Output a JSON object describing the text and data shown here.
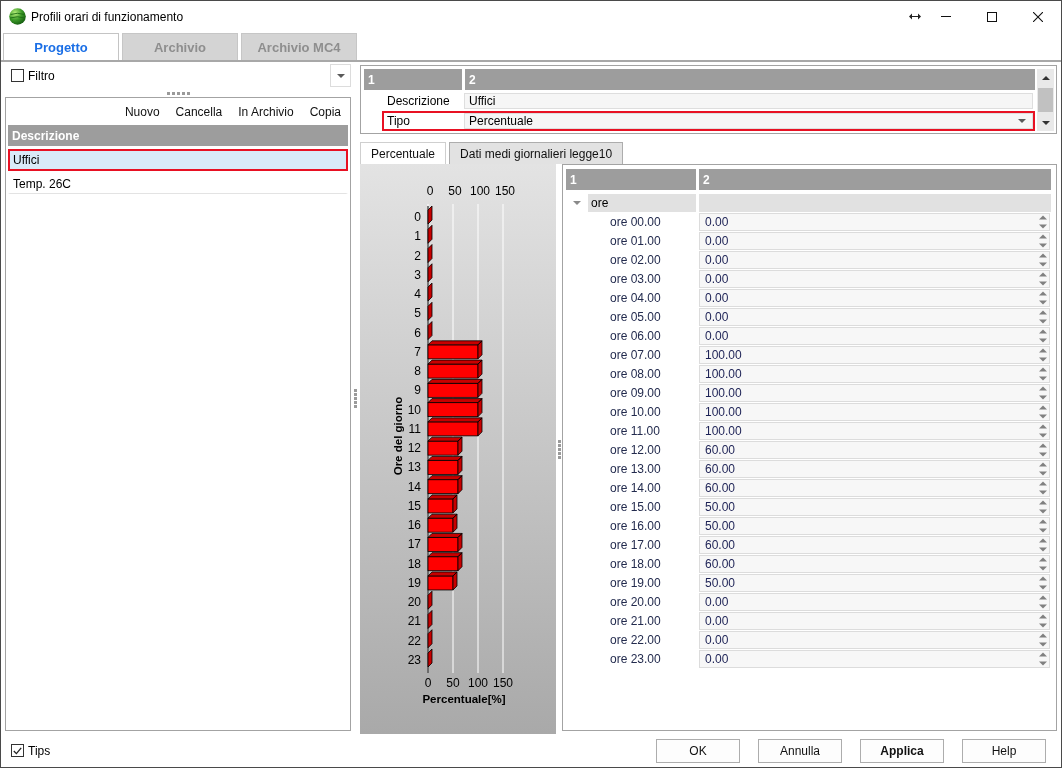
{
  "window": {
    "title": "Profili orari di funzionamento"
  },
  "tabs": [
    {
      "label": "Progetto",
      "selected": true
    },
    {
      "label": "Archivio",
      "selected": false
    },
    {
      "label": "Archivio MC4",
      "selected": false
    }
  ],
  "filter": {
    "label": "Filtro",
    "checked": false
  },
  "toolbar": [
    "Nuovo",
    "Cancella",
    "In Archivio",
    "Copia"
  ],
  "profiles": {
    "column": "Descrizione",
    "items": [
      {
        "label": "Uffici",
        "selected": true,
        "highlighted": true
      },
      {
        "label": "Temp. 26C",
        "selected": false,
        "highlighted": false
      }
    ]
  },
  "properties": {
    "columns": [
      "1",
      "2"
    ],
    "rows": [
      {
        "label": "Descrizione",
        "value": "Uffici",
        "kind": "text",
        "highlighted": false
      },
      {
        "label": "Tipo",
        "value": "Percentuale",
        "kind": "dropdown",
        "highlighted": true
      }
    ]
  },
  "sub_tabs": [
    {
      "label": "Percentuale",
      "selected": true
    },
    {
      "label": "Dati medi giornalieri legge10",
      "selected": false
    }
  ],
  "chart": {
    "top_axis_ticks": [
      "0",
      "50",
      "100",
      "150"
    ],
    "chart_data": {
      "type": "bar",
      "orientation": "horizontal",
      "xlabel": "Percentuale[%]",
      "ylabel": "Ore del giorno",
      "categories": [
        "0",
        "1",
        "2",
        "3",
        "4",
        "5",
        "6",
        "7",
        "8",
        "9",
        "10",
        "11",
        "12",
        "13",
        "14",
        "15",
        "16",
        "17",
        "18",
        "19",
        "20",
        "21",
        "22",
        "23"
      ],
      "values": [
        0,
        0,
        0,
        0,
        0,
        0,
        0,
        100,
        100,
        100,
        100,
        100,
        60,
        60,
        60,
        50,
        50,
        60,
        60,
        50,
        0,
        0,
        0,
        0
      ],
      "xlim": [
        0,
        150
      ],
      "xticks": [
        0,
        50,
        100,
        150
      ]
    }
  },
  "hours": {
    "columns": [
      "1",
      "2"
    ],
    "group": "ore",
    "expanded": true,
    "rows": [
      {
        "label": "ore 00.00",
        "value": "0.00"
      },
      {
        "label": "ore 01.00",
        "value": "0.00"
      },
      {
        "label": "ore 02.00",
        "value": "0.00"
      },
      {
        "label": "ore 03.00",
        "value": "0.00"
      },
      {
        "label": "ore 04.00",
        "value": "0.00"
      },
      {
        "label": "ore 05.00",
        "value": "0.00"
      },
      {
        "label": "ore 06.00",
        "value": "0.00"
      },
      {
        "label": "ore 07.00",
        "value": "100.00"
      },
      {
        "label": "ore 08.00",
        "value": "100.00"
      },
      {
        "label": "ore 09.00",
        "value": "100.00"
      },
      {
        "label": "ore 10.00",
        "value": "100.00"
      },
      {
        "label": "ore 11.00",
        "value": "100.00"
      },
      {
        "label": "ore 12.00",
        "value": "60.00"
      },
      {
        "label": "ore 13.00",
        "value": "60.00"
      },
      {
        "label": "ore 14.00",
        "value": "60.00"
      },
      {
        "label": "ore 15.00",
        "value": "50.00"
      },
      {
        "label": "ore 16.00",
        "value": "50.00"
      },
      {
        "label": "ore 17.00",
        "value": "60.00"
      },
      {
        "label": "ore 18.00",
        "value": "60.00"
      },
      {
        "label": "ore 19.00",
        "value": "50.00"
      },
      {
        "label": "ore 20.00",
        "value": "0.00"
      },
      {
        "label": "ore 21.00",
        "value": "0.00"
      },
      {
        "label": "ore 22.00",
        "value": "0.00"
      },
      {
        "label": "ore 23.00",
        "value": "0.00"
      }
    ]
  },
  "tips": {
    "label": "Tips",
    "checked": true
  },
  "buttons": [
    {
      "label": "OK",
      "default": false
    },
    {
      "label": "Annulla",
      "default": false
    },
    {
      "label": "Applica",
      "default": true
    },
    {
      "label": "Help",
      "default": false
    }
  ]
}
